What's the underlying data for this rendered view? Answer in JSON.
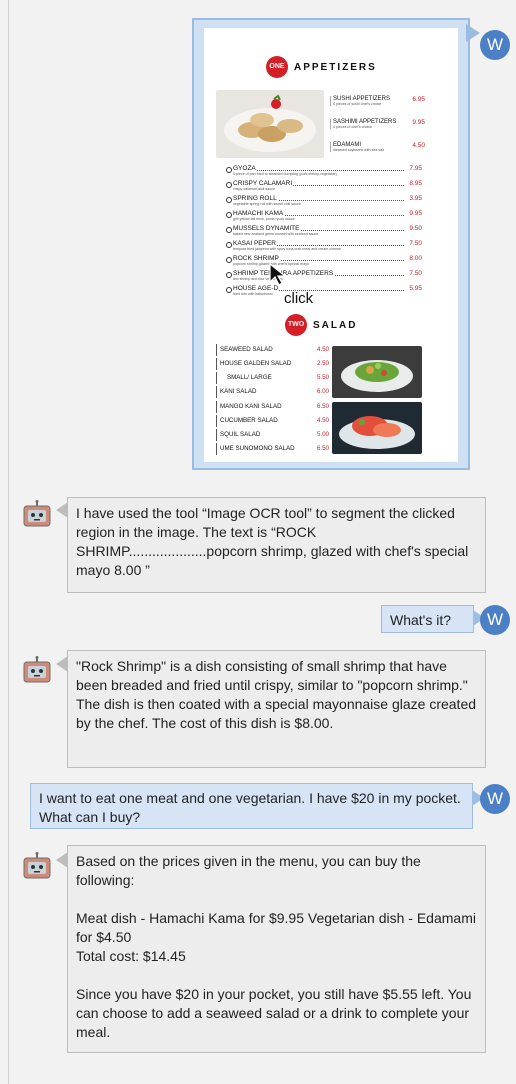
{
  "user_avatar_letter": "W",
  "menu": {
    "appetizers": {
      "badge": "ONE",
      "title": "APPETIZERS"
    },
    "salad": {
      "badge": "TWO",
      "title": "SALAD"
    },
    "top_items": [
      {
        "name": "SUSHI APPETIZERS",
        "price": "6.95",
        "desc": "4 pieces of sushi chef's choice"
      },
      {
        "name": "SASHIMI APPETIZERS",
        "price": "9.95",
        "desc": "4 pieces of chef's choice"
      },
      {
        "name": "EDAMAMI",
        "price": "4.50",
        "desc": "steamed soybeans with sea salt"
      }
    ],
    "items": [
      {
        "name": "GYOZA",
        "price": "7.95",
        "desc": "6 piece of pan fried or steamed dumpling (pork,shrimp,vegetable)"
      },
      {
        "name": "CRISPY CALAMARI",
        "price": "8.95",
        "desc": "crispy calamari,aioli sauce"
      },
      {
        "name": "SPRING ROLL",
        "price": "3.95",
        "desc": "vegetable spring roll with sweet chili sauce"
      },
      {
        "name": "HAMACHI KAMA",
        "price": "9.95",
        "desc": "grill yellow tail neck, ponzu yuzu sauce"
      },
      {
        "name": "MUSSELS DYNAMITE",
        "price": "9.50",
        "desc": "baked new zealand green mussel with seafood sauce"
      },
      {
        "name": "KASAI PEPER",
        "price": "7.50",
        "desc": "tempura fried jalapeno with spicy tuna,crab meat and cream cheese"
      },
      {
        "name": "ROCK SHRIMP",
        "price": "8.00",
        "desc": "popcorn shrimp,glazed with chef's special mayo"
      },
      {
        "name": "SHRIMP TEMPURA APPETIZERS",
        "price": "7.50",
        "desc": "two shrimp and four vegetables"
      },
      {
        "name": "HOUSE AGE-D",
        "price": "5.95",
        "desc": "fried tofu with katsubushi"
      }
    ],
    "salads": [
      {
        "name": "SEAWEED SALAD",
        "price": "4.50"
      },
      {
        "name": "HOUSE GALDEN SALAD",
        "price": "2.50"
      },
      {
        "name": "SMALL/ LARGE",
        "price": "5.50"
      },
      {
        "name": "KANI SALAD",
        "price": "6.00"
      },
      {
        "name": "MANGO KANI SALAD",
        "price": "6.50"
      },
      {
        "name": "CUCUMBER SALAD",
        "price": "4.50"
      },
      {
        "name": "SQUIL SALAD",
        "price": "5.00"
      },
      {
        "name": "UME SUNOMONO SALAD",
        "price": "6.50"
      }
    ],
    "click_label": "click"
  },
  "chat": {
    "msg1": "I have used the tool “Image OCR tool” to segment the clicked region in the image. The text is “ROCK SHRIMP....................popcorn shrimp, glazed with chef's special mayo 8.00 ”",
    "msg2": "What's it?",
    "msg3": "\"Rock Shrimp\" is a dish consisting of small shrimp that have been breaded and fried until crispy, similar to \"popcorn shrimp.\" The dish is then coated with a special mayonnaise glaze created by the chef. The cost of this dish is $8.00.",
    "msg4": "I want to eat one meat and one vegetarian. I have $20 in my pocket. What can I buy?",
    "msg5": "Based on the prices given in the menu, you can buy the following:\n\nMeat dish - Hamachi Kama for $9.95 Vegetarian dish - Edamami for $4.50\nTotal cost: $14.45\n\nSince you have $20 in your pocket, you still have $5.55 left. You can choose to add a seaweed salad or a drink to complete your meal."
  }
}
